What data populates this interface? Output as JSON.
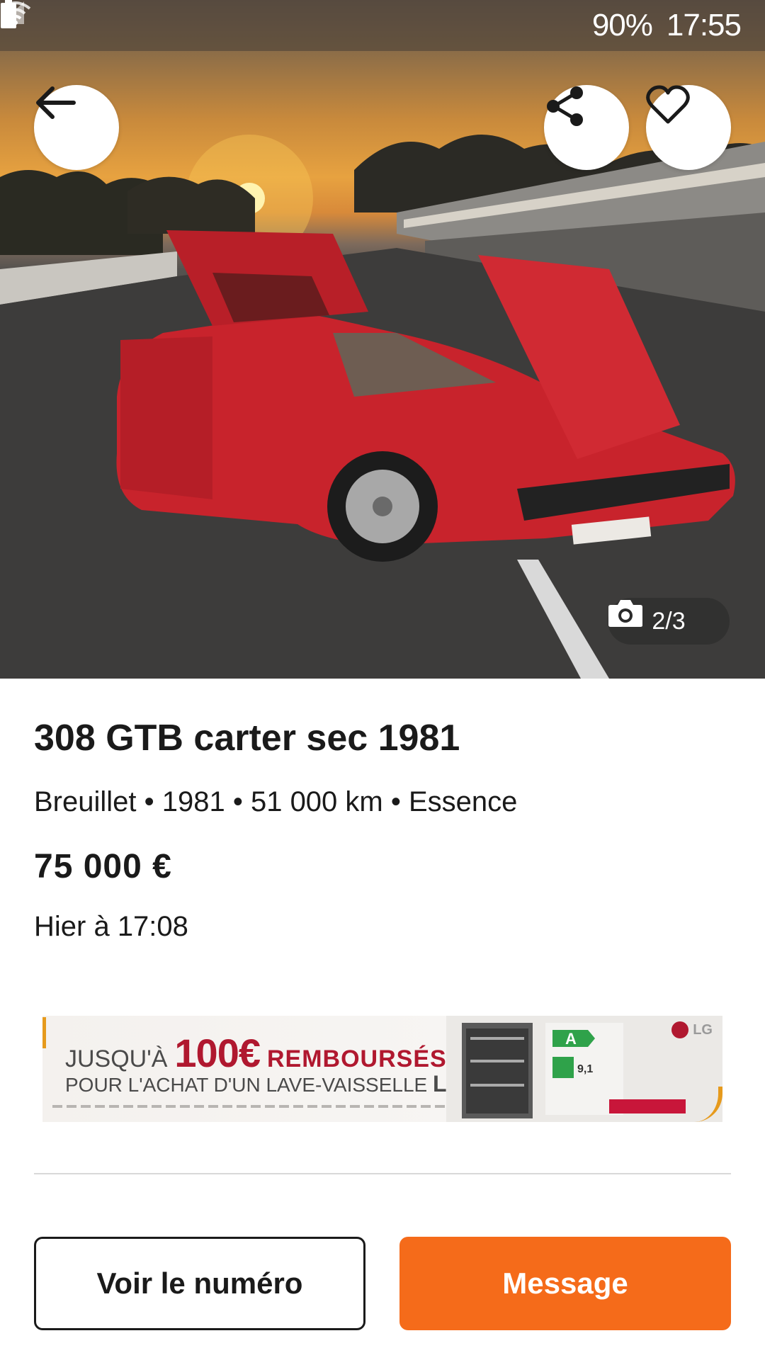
{
  "status_bar": {
    "battery": "90%",
    "time": "17:55",
    "icons": [
      "wifi-icon",
      "signal-icon",
      "battery-icon"
    ]
  },
  "hero": {
    "back_icon": "arrow-left-icon",
    "share_icon": "share-icon",
    "favorite_icon": "heart-icon",
    "camera_icon": "camera-icon",
    "photo_counter": "2/3",
    "image_description": "Red Ferrari 308 GTB on a race track at sunset"
  },
  "listing": {
    "title": "308 GTB carter sec 1981",
    "subtitle": "Breuillet • 1981 • 51 000 km • Essence",
    "price": "75 000 €",
    "date": "Hier à 17:08"
  },
  "ad": {
    "prefix": "JUSQU'À",
    "amount": "100€",
    "headline": "REMBOURSÉS",
    "line2": "POUR L'ACHAT D'UN LAVE-VAISSELLE",
    "brand": "LG",
    "energy_class": "A",
    "rating": "9,1"
  },
  "actions": {
    "phone_label": "Voir le numéro",
    "message_label": "Message"
  },
  "colors": {
    "accent": "#f56b1a",
    "text": "#1a1a1a",
    "car_red": "#c8232c"
  }
}
